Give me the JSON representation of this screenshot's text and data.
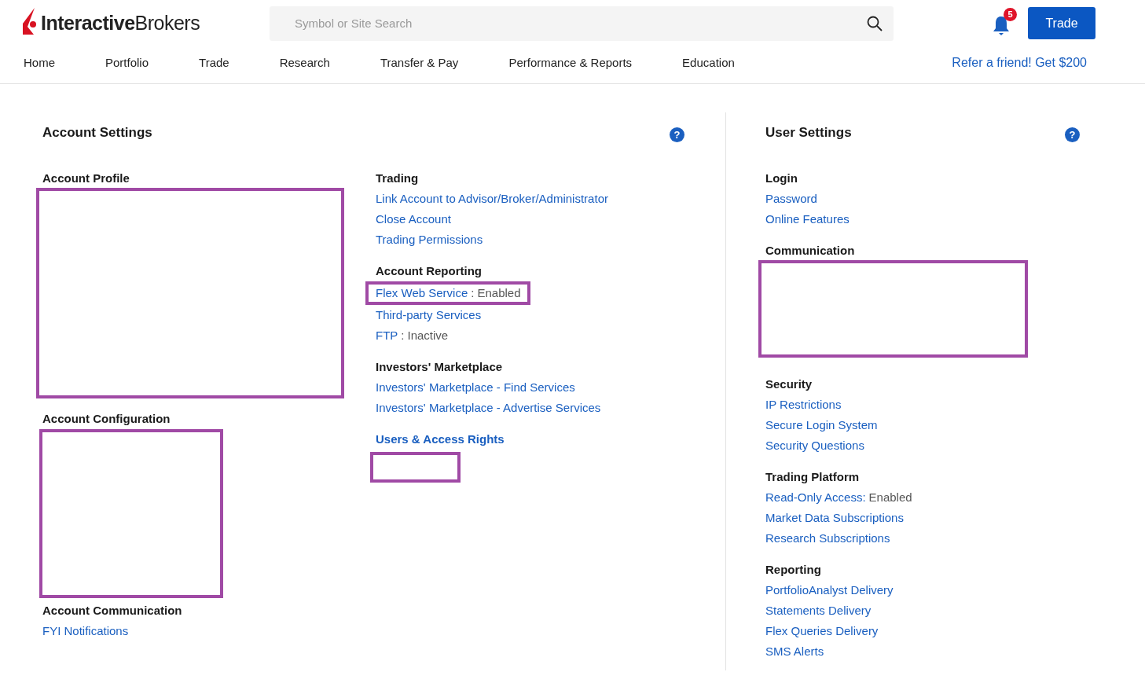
{
  "header": {
    "logo": {
      "bold": "Interactive",
      "light": "Brokers"
    },
    "search": {
      "placeholder": "Symbol or Site Search"
    },
    "notifications": {
      "count": "5"
    },
    "trade_button": "Trade",
    "nav": [
      {
        "label": "Home"
      },
      {
        "label": "Portfolio"
      },
      {
        "label": "Trade"
      },
      {
        "label": "Research"
      },
      {
        "label": "Transfer & Pay"
      },
      {
        "label": "Performance & Reports"
      },
      {
        "label": "Education"
      }
    ],
    "promo": "Refer a friend! Get $200"
  },
  "account_settings": {
    "title": "Account Settings",
    "help_icon": "?",
    "columns": [
      [
        {
          "heading": "Account Profile",
          "kind": "title",
          "items": [
            {
              "kind": "blank-large"
            }
          ]
        },
        {
          "heading": "Account Configuration",
          "kind": "title",
          "items": [
            {
              "kind": "blank-tall"
            }
          ]
        },
        {
          "heading": "Account Communication",
          "kind": "title",
          "items": [
            {
              "kind": "link",
              "label": "FYI Notifications"
            }
          ]
        }
      ],
      [
        {
          "heading": "Trading",
          "kind": "title",
          "items": [
            {
              "kind": "link",
              "label": "Link Account to Advisor/Broker/Administrator"
            },
            {
              "kind": "link",
              "label": "Close Account"
            },
            {
              "kind": "link",
              "label": "Trading Permissions"
            }
          ]
        },
        {
          "heading": "Account Reporting",
          "kind": "title",
          "items": [
            {
              "kind": "link",
              "label": "Flex Web Service",
              "status": "Enabled",
              "separator": ":",
              "highlighted": true
            },
            {
              "kind": "link",
              "label": "Third-party Services"
            },
            {
              "kind": "link",
              "label": "FTP",
              "status": "Inactive",
              "separator": ":"
            }
          ]
        },
        {
          "heading": "Investors' Marketplace",
          "kind": "title",
          "items": [
            {
              "kind": "link",
              "label": "Investors' Marketplace - Find Services"
            },
            {
              "kind": "link",
              "label": "Investors' Marketplace - Advertise Services"
            }
          ]
        },
        {
          "heading": "Users & Access Rights",
          "kind": "link",
          "items": [
            {
              "kind": "blank-small"
            }
          ]
        }
      ]
    ]
  },
  "user_settings": {
    "title": "User Settings",
    "help_icon": "?",
    "sections": [
      {
        "heading": "Login",
        "kind": "title",
        "items": [
          {
            "kind": "link",
            "label": "Password"
          },
          {
            "kind": "link",
            "label": "Online Features"
          }
        ]
      },
      {
        "heading": "Communication",
        "kind": "title",
        "items": [
          {
            "kind": "blank-wide"
          }
        ]
      },
      {
        "heading": "Security",
        "kind": "title",
        "items": [
          {
            "kind": "link",
            "label": "IP Restrictions"
          },
          {
            "kind": "link",
            "label": "Secure Login System"
          },
          {
            "kind": "link",
            "label": "Security Questions"
          }
        ]
      },
      {
        "heading": "Trading Platform",
        "kind": "title",
        "items": [
          {
            "kind": "link",
            "label": "Read-Only Access:",
            "status": "Enabled"
          },
          {
            "kind": "link",
            "label": "Market Data Subscriptions"
          },
          {
            "kind": "link",
            "label": "Research Subscriptions"
          }
        ]
      },
      {
        "heading": "Reporting",
        "kind": "title",
        "items": [
          {
            "kind": "link",
            "label": "PortfolioAnalyst Delivery"
          },
          {
            "kind": "link",
            "label": "Statements Delivery"
          },
          {
            "kind": "link",
            "label": "Flex Queries Delivery"
          },
          {
            "kind": "link",
            "label": "SMS Alerts"
          }
        ]
      }
    ]
  }
}
